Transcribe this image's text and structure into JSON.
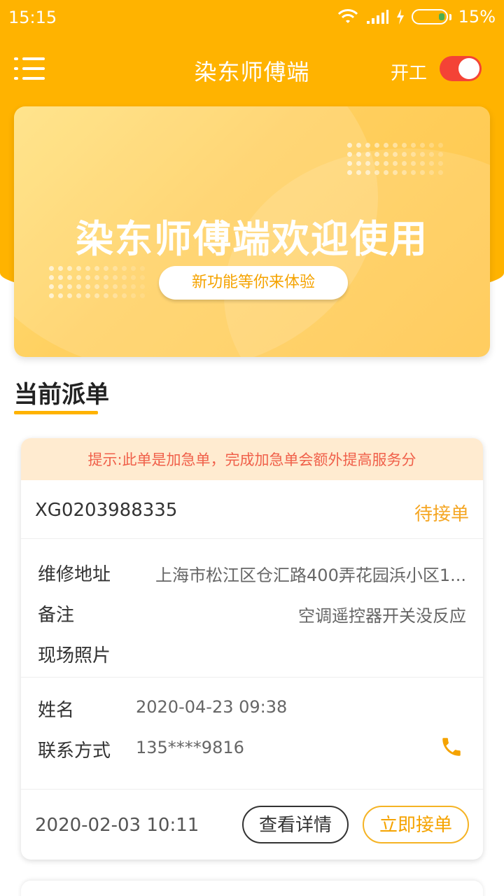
{
  "status_bar": {
    "time": "15:15",
    "battery": "15%"
  },
  "app_bar": {
    "title": "染东师傅端",
    "work_label": "开工",
    "work_on": true,
    "toggle_color": "#F44336"
  },
  "banner": {
    "title": "染东师傅端欢迎使用",
    "button_label": "新功能等你来体验"
  },
  "section": {
    "title": "当前派单"
  },
  "order": {
    "tip": "提示:此单是加急单，完成加急单会额外提高服务分",
    "number": "XG0203988335",
    "status": "待接单",
    "address_label": "维修地址",
    "address_value": "上海市松江区仓汇路400弄花园浜小区1...",
    "remark_label": "备注",
    "remark_value": "空调遥控器开关没反应",
    "photo_label": "现场照片",
    "name_label": "姓名",
    "name_value": "2020-04-23 09:38",
    "contact_label": "联系方式",
    "contact_value": "135****9816",
    "created_time": "2020-02-03 10:11",
    "detail_button": "查看详情",
    "accept_button": "立即接单"
  },
  "colors": {
    "brand": "#FFB300",
    "accent_text": "#F5A300",
    "tip_text": "#F0604A",
    "tip_bg": "#FFEBD0"
  }
}
